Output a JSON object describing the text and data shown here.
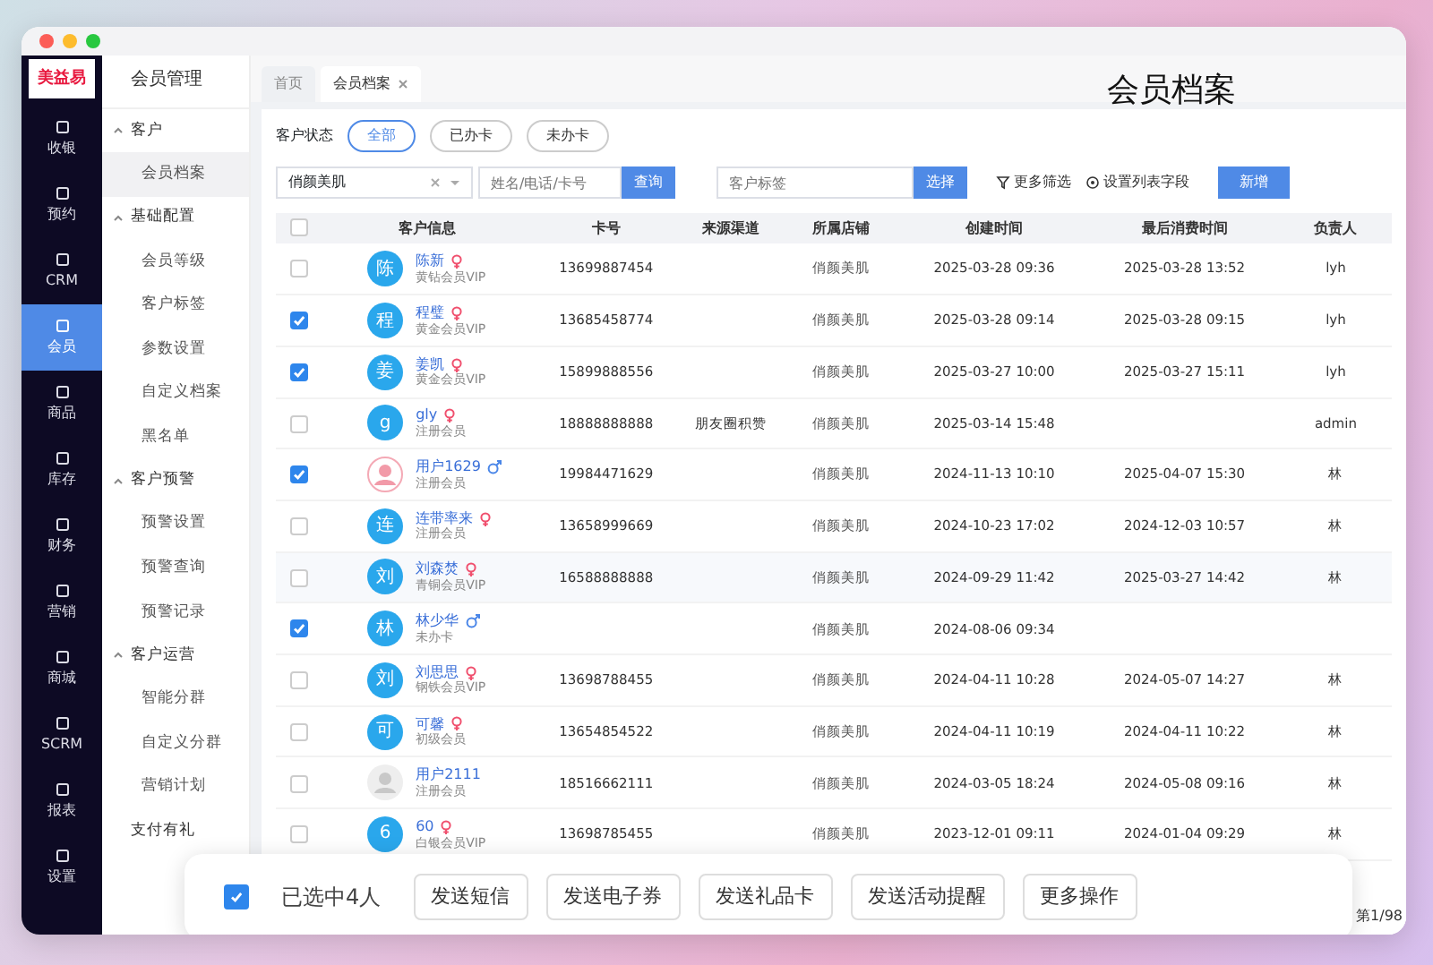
{
  "nav": {
    "logo": "美益易",
    "items": [
      {
        "label": "收银",
        "selected": false
      },
      {
        "label": "预约",
        "selected": false
      },
      {
        "label": "CRM",
        "selected": false
      },
      {
        "label": "会员",
        "selected": true
      },
      {
        "label": "商品",
        "selected": false
      },
      {
        "label": "库存",
        "selected": false
      },
      {
        "label": "财务",
        "selected": false
      },
      {
        "label": "营销",
        "selected": false
      },
      {
        "label": "商城",
        "selected": false
      },
      {
        "label": "SCRM",
        "selected": false
      },
      {
        "label": "报表",
        "selected": false
      },
      {
        "label": "设置",
        "selected": false
      }
    ]
  },
  "submenu": {
    "title": "会员管理",
    "sections": [
      {
        "label": "客户",
        "expanded": true,
        "children": [
          {
            "label": "会员档案",
            "selected": true
          }
        ]
      },
      {
        "label": "基础配置",
        "expanded": true,
        "children": [
          {
            "label": "会员等级",
            "selected": false
          },
          {
            "label": "客户标签",
            "selected": false
          },
          {
            "label": "参数设置",
            "selected": false
          },
          {
            "label": "自定义档案",
            "selected": false
          },
          {
            "label": "黑名单",
            "selected": false
          }
        ]
      },
      {
        "label": "客户预警",
        "expanded": true,
        "children": [
          {
            "label": "预警设置",
            "selected": false
          },
          {
            "label": "预警查询",
            "selected": false
          },
          {
            "label": "预警记录",
            "selected": false
          }
        ]
      },
      {
        "label": "客户运营",
        "expanded": true,
        "children": [
          {
            "label": "智能分群",
            "selected": false
          },
          {
            "label": "自定义分群",
            "selected": false
          },
          {
            "label": "营销计划",
            "selected": false
          }
        ]
      },
      {
        "label": "支付有礼",
        "expanded": false
      }
    ]
  },
  "tabs": [
    {
      "label": "首页",
      "selected": false
    },
    {
      "label": "会员档案",
      "selected": true
    }
  ],
  "page_title": "会员档案",
  "filters": {
    "status_label": "客户状态",
    "status_options": [
      {
        "label": "全部",
        "selected": true
      },
      {
        "label": "已办卡",
        "selected": false
      },
      {
        "label": "未办卡",
        "selected": false
      }
    ],
    "store": {
      "value": "俏颜美肌"
    },
    "search": {
      "placeholder": "姓名/电话/卡号",
      "button": "查询"
    },
    "tag": {
      "placeholder": "客户标签",
      "button": "选择"
    },
    "more_filter": "更多筛选",
    "list_fields": "设置列表字段",
    "add_button": "新增"
  },
  "table": {
    "select_all": {
      "checked": false
    },
    "columns": [
      "客户信息",
      "卡号",
      "来源渠道",
      "所属店铺",
      "创建时间",
      "最后消费时间",
      "负责人"
    ],
    "rows": [
      {
        "checked": false,
        "kind": "letter",
        "avatar_text": "陈",
        "name": "陈新",
        "female": true,
        "male": false,
        "level": "黄钻会员VIP",
        "card": "13699887454",
        "source": "",
        "store": "俏颜美肌",
        "created": "2025-03-28 09:36",
        "last": "2025-03-28 13:52",
        "owner": "lyh"
      },
      {
        "checked": true,
        "kind": "letter",
        "avatar_text": "程",
        "name": "程璧",
        "female": true,
        "male": false,
        "level": "黄金会员VIP",
        "card": "13685458774",
        "source": "",
        "store": "俏颜美肌",
        "created": "2025-03-28 09:14",
        "last": "2025-03-28 09:15",
        "owner": "lyh"
      },
      {
        "checked": true,
        "kind": "letter",
        "avatar_text": "姜",
        "name": "姜凯",
        "female": true,
        "male": false,
        "level": "黄金会员VIP",
        "card": "15899888556",
        "source": "",
        "store": "俏颜美肌",
        "created": "2025-03-27 10:00",
        "last": "2025-03-27 15:11",
        "owner": "lyh"
      },
      {
        "checked": false,
        "kind": "letter",
        "avatar_text": "g",
        "name": "gly",
        "female": true,
        "male": false,
        "level": "注册会员",
        "card": "18888888888",
        "source": "朋友圈积赞",
        "store": "俏颜美肌",
        "created": "2025-03-14 15:48",
        "last": "",
        "owner": "admin"
      },
      {
        "checked": true,
        "kind": "pink",
        "name": "用户1629",
        "female": false,
        "male": true,
        "level": "注册会员",
        "card": "19984471629",
        "source": "",
        "store": "俏颜美肌",
        "created": "2024-11-13 10:10",
        "last": "2025-04-07 15:30",
        "owner": "林"
      },
      {
        "checked": false,
        "kind": "letter",
        "avatar_text": "连",
        "name": "连带率来",
        "female": true,
        "male": false,
        "level": "注册会员",
        "card": "13658999669",
        "source": "",
        "store": "俏颜美肌",
        "created": "2024-10-23 17:02",
        "last": "2024-12-03 10:57",
        "owner": "林"
      },
      {
        "checked": false,
        "kind": "letter",
        "avatar_text": "刘",
        "name": "刘森焚",
        "female": true,
        "male": false,
        "level": "青铜会员VIP",
        "card": "16588888888",
        "source": "",
        "store": "俏颜美肌",
        "created": "2024-09-29 11:42",
        "last": "2025-03-27 14:42",
        "owner": "林"
      },
      {
        "checked": true,
        "kind": "letter",
        "avatar_text": "林",
        "name": "林少华",
        "female": false,
        "male": true,
        "level": "未办卡",
        "card": "",
        "source": "",
        "store": "俏颜美肌",
        "created": "2024-08-06 09:34",
        "last": "",
        "owner": ""
      },
      {
        "checked": false,
        "kind": "letter",
        "avatar_text": "刘",
        "name": "刘思思",
        "female": true,
        "male": false,
        "level": "钢铁会员VIP",
        "card": "13698788455",
        "source": "",
        "store": "俏颜美肌",
        "created": "2024-04-11 10:28",
        "last": "2024-05-07 14:27",
        "owner": "林"
      },
      {
        "checked": false,
        "kind": "letter",
        "avatar_text": "可",
        "name": "可馨",
        "female": true,
        "male": false,
        "level": "初级会员",
        "card": "13654854522",
        "source": "",
        "store": "俏颜美肌",
        "created": "2024-04-11 10:19",
        "last": "2024-04-11 10:22",
        "owner": "林"
      },
      {
        "checked": false,
        "kind": "default",
        "name": "用户2111",
        "female": false,
        "male": false,
        "level": "注册会员",
        "card": "18516662111",
        "source": "",
        "store": "俏颜美肌",
        "created": "2024-03-05 18:24",
        "last": "2024-05-08 09:16",
        "owner": "林"
      },
      {
        "checked": false,
        "kind": "letter",
        "avatar_text": "6",
        "name": "60",
        "female": true,
        "male": false,
        "level": "白银会员VIP",
        "card": "13698785455",
        "source": "",
        "store": "俏颜美肌",
        "created": "2023-12-01 09:11",
        "last": "2024-01-04 09:29",
        "owner": "林"
      }
    ]
  },
  "pagination_text": "第1/98",
  "bulk_bar": {
    "checked": true,
    "text": "已选中4人",
    "buttons": [
      "发送短信",
      "发送电子券",
      "发送礼品卡",
      "发送活动提醒",
      "更多操作"
    ]
  }
}
